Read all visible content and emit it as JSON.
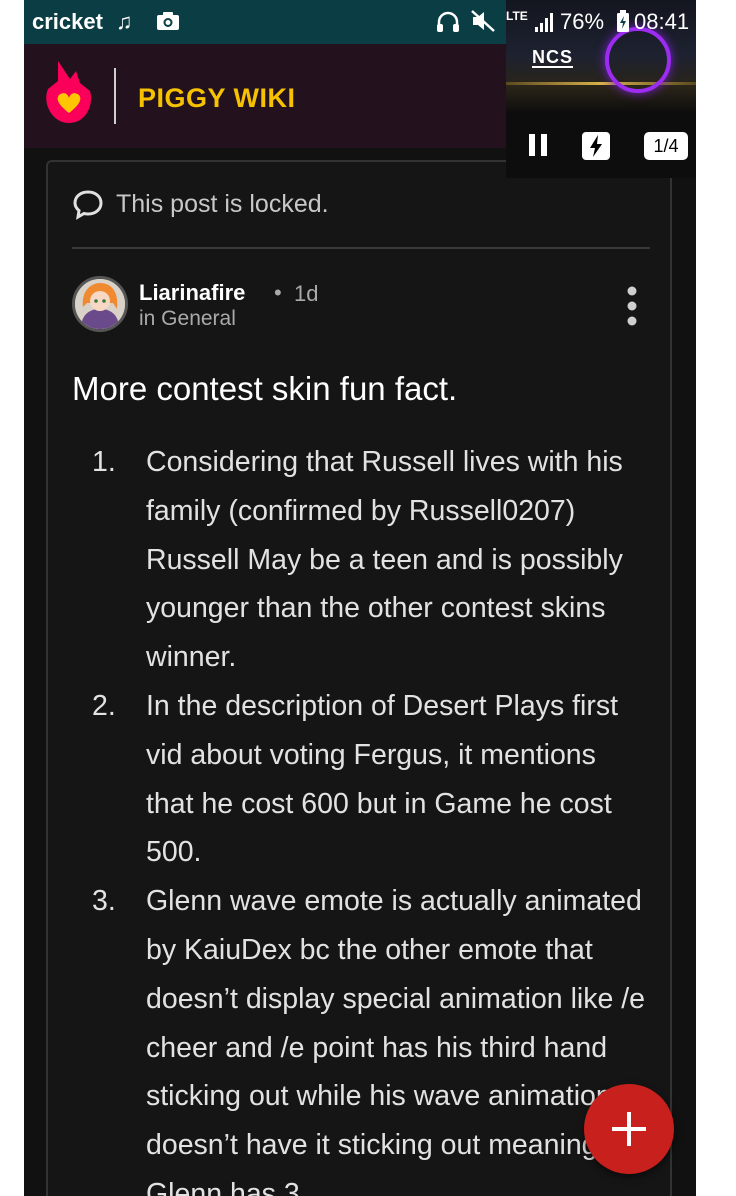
{
  "status_bar": {
    "carrier": "cricket",
    "lte_label": "LTE",
    "battery_percent": "76%",
    "time": "08:41"
  },
  "header": {
    "wiki_title": "PIGGY WIKI"
  },
  "media_player": {
    "brand": "NCS",
    "page_counter": "1/4"
  },
  "post": {
    "locked_notice": "This post is locked.",
    "author": "Liarinafire",
    "separator": "•",
    "age": "1d",
    "category": "in General",
    "title": "More contest skin fun fact.",
    "items": [
      {
        "number": "1.",
        "text": "Considering that Russell lives with his family (confirmed by Russell0207) Russell May be a teen and is possibly younger than the other contest skins winner."
      },
      {
        "number": "2.",
        "text": "In the description of Desert Plays first vid about voting Fergus, it mentions that he cost 600 but in Game he cost 500."
      },
      {
        "number": "3.",
        "text": "Glenn wave emote is actually animated by KaiuDex bc the other emote that doesn’t display special animation like /e cheer and /e point has his third hand sticking out while his wave animation doesn’t have it sticking out meaning Glenn has 3"
      }
    ]
  },
  "colors": {
    "accent_yellow": "#f6c200",
    "fab_red": "#c8201c",
    "header_bg": "#23121e",
    "status_bar_bg": "#0b3d45",
    "visualizer_purple": "#9b2cf0"
  },
  "icons": {
    "status": [
      "music-note-icon",
      "camera-icon",
      "headphones-icon",
      "mute-icon",
      "signal-icon",
      "battery-icon"
    ],
    "post": [
      "chat-bubble-icon",
      "more-vertical-icon",
      "plus-icon"
    ],
    "media": [
      "pause-icon",
      "bolt-icon"
    ]
  }
}
